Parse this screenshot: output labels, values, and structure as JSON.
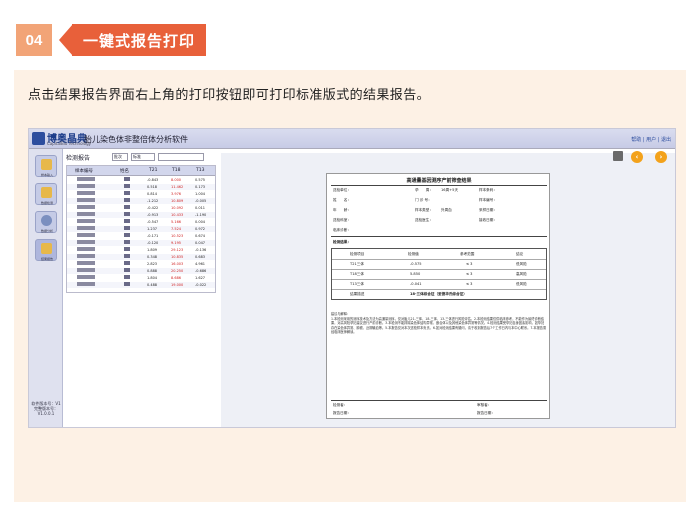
{
  "step": {
    "number": "04",
    "title": "一键式报告打印"
  },
  "description": "点击结果报告界面右上角的打印按钮即可打印标准版式的结果报告。",
  "app": {
    "brand": "博奥晶典",
    "brand_sub": "CapitalBio Technology",
    "title": "胎儿染色体非整倍体分析软件",
    "top_links": "帮助 | 用户 | 退出",
    "sidebar": [
      {
        "label": "样本输入",
        "icon": "sample-entry-icon"
      },
      {
        "label": "数据检测",
        "icon": "data-clipboard-icon"
      },
      {
        "label": "数据分析",
        "icon": "magnifier-icon"
      },
      {
        "label": "结果报告",
        "icon": "report-chart-icon"
      }
    ],
    "version": "软件版本号：V1 完整版本号：V1.0.0.1",
    "list_header": "检测报告",
    "filter_a": "批次",
    "filter_b": "标准",
    "columns": [
      "样本编号",
      "姓名",
      "T21",
      "T18",
      "T13"
    ],
    "rows": [
      {
        "t21": "-0.843",
        "t18": "8.000",
        "t13": "0.575"
      },
      {
        "t21": "0.518",
        "t18": "11.462",
        "t13": "0.173"
      },
      {
        "t21": "0.814",
        "t18": "3.976",
        "t13": "1.004"
      },
      {
        "t21": "-1.212",
        "t18": "10.809",
        "t13": "-0.005"
      },
      {
        "t21": "-0.422",
        "t18": "10.092",
        "t13": "0.011"
      },
      {
        "t21": "-0.913",
        "t18": "10.433",
        "t13": "-1.190"
      },
      {
        "t21": "-0.547",
        "t18": "5.166",
        "t13": "0.004"
      },
      {
        "t21": "1.237",
        "t18": "7.524",
        "t13": "0.972"
      },
      {
        "t21": "-0.171",
        "t18": "10.523",
        "t13": "0.674"
      },
      {
        "t21": "-0.120",
        "t18": "9.195",
        "t13": "0.047"
      },
      {
        "t21": "1.809",
        "t18": "29.123",
        "t13": "-0.136"
      },
      {
        "t21": "0.348",
        "t18": "10.835",
        "t13": "0.683"
      },
      {
        "t21": "2.823",
        "t18": "16.003",
        "t13": "4.961"
      },
      {
        "t21": "0.888",
        "t18": "20.250",
        "t13": "-0.686"
      },
      {
        "t21": "1.804",
        "t18": "8.686",
        "t13": "1.627"
      },
      {
        "t21": "0.488",
        "t18": "19.000",
        "t13": "-0.022"
      }
    ],
    "report": {
      "title": "高通量基因测序产前筛查结果",
      "fields": [
        "送检单位：",
        "孕　　周：",
        "16周+5天",
        "样本条码：",
        "姓　　名：",
        "门  诊  号：",
        "样本编号：",
        "年　　龄：",
        "样本类型：",
        "外周血",
        "采样日期：",
        "送检科室：",
        "送检医生：",
        "接收日期：",
        "临床诊断："
      ],
      "section": "检测结果：",
      "table_head": [
        "检测项目",
        "检测值",
        "参考范围",
        "结论"
      ],
      "table_rows": [
        [
          "T21三体",
          "-0.575",
          "≤ 3",
          "低风险"
        ],
        [
          "T18三体",
          "5.850",
          "≤ 3",
          "高风险"
        ],
        [
          "T13三体",
          "-0.041",
          "≤ 3",
          "低风险"
        ]
      ],
      "summary_label": "结果描述",
      "summary": "18-三体综合征（爱德华氏综合征）",
      "advice_title": "建议与解释：",
      "advice": "1.本检测采用的测序技术及方法为高通量测序，仅对胎儿21-三体、18-三体、13-三体进行风险评估。2.本检测结果仅供临床参考，不能作为最终诊断结果，对高风险孕妇建议进行产前诊断。3.本检测不能排除染色体结构异常、嵌合体以及其他染色体异常等情况。4.检测结果受孕妇自身因素影响，如孕妇存在染色体异常、肿瘤、近期输血等。5.本报告仅对本次送检样本负责。6.如对检测结果有疑问，请于收到报告后7个工作日内与本中心联系。7.本报告需经临床医师解读。",
      "sign": [
        "检测者：",
        "审核者：",
        "报告日期：",
        "报告日期："
      ]
    }
  }
}
